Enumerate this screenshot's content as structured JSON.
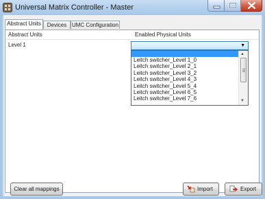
{
  "window": {
    "title": "Universal Matrix Controller - Master",
    "icon": "app-icon",
    "controls": [
      "minimize-icon",
      "maximize-icon",
      "close-icon"
    ]
  },
  "tabs": [
    {
      "label": "Abstract Units",
      "active": true
    },
    {
      "label": "Devices",
      "active": false
    },
    {
      "label": "UMC Configuration",
      "active": false
    }
  ],
  "table": {
    "headers": [
      "Abstract Units",
      "Enabled Physical Units"
    ],
    "rows": [
      {
        "abstract_unit": "Level 1"
      }
    ]
  },
  "combo": {
    "value": "",
    "options": [
      "Leitch switcher_Level 1_0",
      "Leitch switcher_Level 2_1",
      "Leitch switcher_Level 3_2",
      "Leitch switcher_Level 4_3",
      "Leitch switcher_Level 5_4",
      "Leitch switcher_Level 6_5",
      "Leitch switcher_Level 7_6"
    ]
  },
  "buttons": {
    "clear": "Clear all mappings",
    "import": "Import",
    "export": "Export"
  },
  "colors": {
    "selection": "#3399ff",
    "combo_border": "#3c7fb1",
    "title_bar": "#b3cfec"
  }
}
